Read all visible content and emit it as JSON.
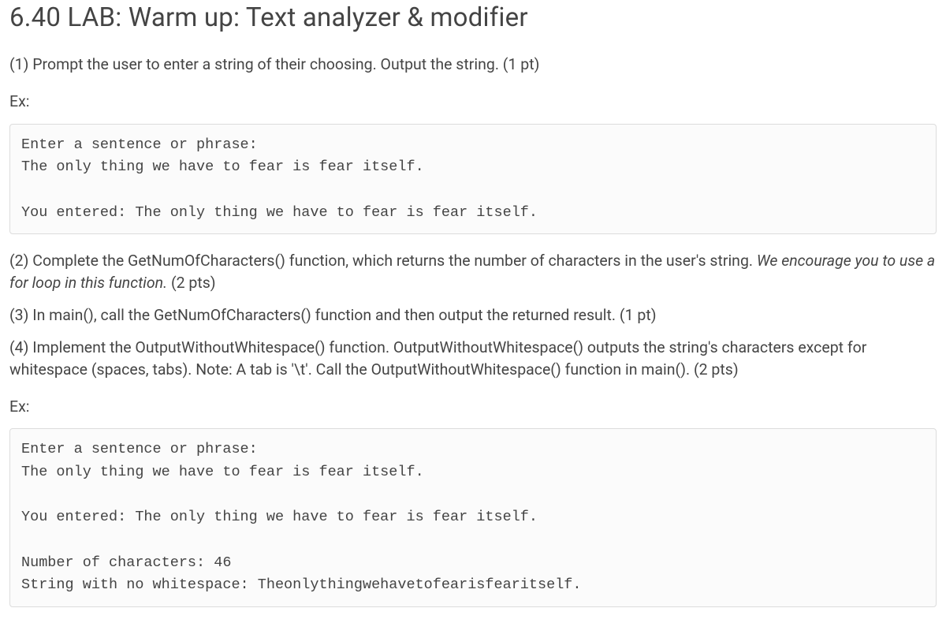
{
  "title": "6.40 LAB: Warm up: Text analyzer & modifier",
  "step1": "(1) Prompt the user to enter a string of their choosing. Output the string. (1 pt)",
  "ex1_label": "Ex:",
  "ex1_code": "Enter a sentence or phrase:\nThe only thing we have to fear is fear itself.\n\nYou entered: The only thing we have to fear is fear itself.",
  "step2_a": "(2) Complete the GetNumOfCharacters() function, which returns the number of characters in the user's string. ",
  "step2_italic": "We encourage you to use a for loop in this function.",
  "step2_b": " (2 pts)",
  "step3": "(3) In main(), call the GetNumOfCharacters() function and then output the returned result. (1 pt)",
  "step4": "(4) Implement the OutputWithoutWhitespace() function. OutputWithoutWhitespace() outputs the string's characters except for whitespace (spaces, tabs). Note: A tab is '\\t'. Call the OutputWithoutWhitespace() function in main(). (2 pts)",
  "ex2_label": "Ex:",
  "ex2_code": "Enter a sentence or phrase:\nThe only thing we have to fear is fear itself.\n\nYou entered: The only thing we have to fear is fear itself.\n\nNumber of characters: 46\nString with no whitespace: Theonlythingwehavetofearisfearitself."
}
